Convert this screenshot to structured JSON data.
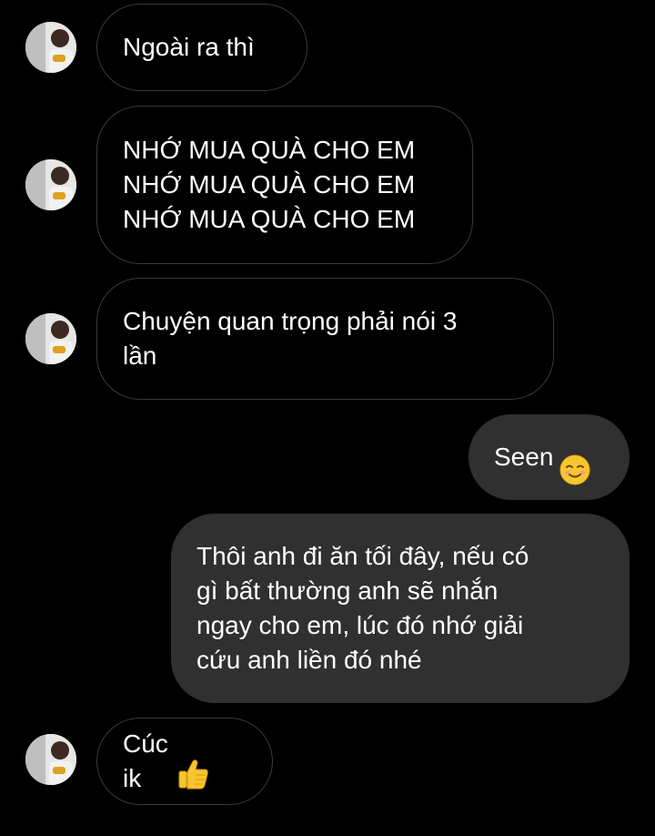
{
  "messages": [
    {
      "direction": "incoming",
      "text": "Ngoài ra thì"
    },
    {
      "direction": "incoming",
      "text": "NHỚ MUA QUÀ CHO EM\nNHỚ MUA QUÀ CHO EM\nNHỚ MUA QUÀ CHO EM"
    },
    {
      "direction": "incoming",
      "text": "Chuyện quan trọng phải nói 3\nlần"
    },
    {
      "direction": "outgoing",
      "text": "Seen",
      "emoji": "smiling-face-emoji"
    },
    {
      "direction": "outgoing",
      "text": "Thôi anh đi ăn tối đây, nếu có\ngì bất thường anh sẽ nhắn\nngay cho em, lúc đó nhớ giải\ncứu anh liền đó nhé"
    },
    {
      "direction": "incoming",
      "text": "Cúc ik",
      "emoji": "thumbs-up-emoji"
    }
  ],
  "colors": {
    "background": "#000000",
    "incoming_border": "#3a3a3a",
    "outgoing_bubble": "#303030",
    "text": "#ffffff"
  }
}
